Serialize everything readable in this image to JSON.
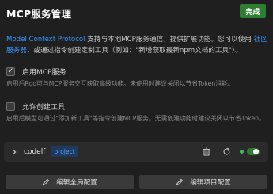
{
  "header": {
    "title": "MCP服务管理",
    "done_label": "完成"
  },
  "intro": {
    "link1": "Model Context Protocol",
    "text1": " 支持与本地MCP服务通信，提供扩展功能。您可以使用 ",
    "link2": "社区服务器",
    "text2": "，或通过指令创建定制工具（例如：\"新增获取最新npm文档的工具\"）。"
  },
  "options": [
    {
      "label": "启用MCP服务",
      "checked": true,
      "check_glyph": "✓",
      "description": "启用后Roo可与MCP服务交互获取高级功能。未使用时建议关闭以节省Token消耗。"
    },
    {
      "label": "允许创建工具",
      "checked": false,
      "check_glyph": "",
      "description": "启用后模型可通过\"添加新工具\"等指令创建MCP服务。无需创建功能时建议关闭以节省Token。"
    }
  ],
  "server": {
    "name": "codelf",
    "badge": "project",
    "status_color": "#37c05a",
    "enabled": true,
    "icons": [
      "chevron-right-icon",
      "trash-icon",
      "refresh-icon",
      "status-dot",
      "toggle"
    ]
  },
  "footer": {
    "edit_global_label": "编辑全局配置",
    "edit_project_label": "编辑项目配置"
  },
  "colors": {
    "background": "#1f1f1f",
    "accent_green": "#2e7d32",
    "link_blue": "#3794ff"
  }
}
